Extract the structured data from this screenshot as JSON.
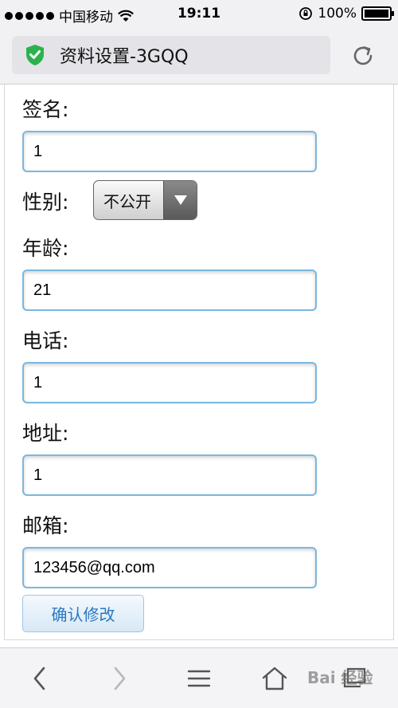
{
  "status_bar": {
    "carrier": "中国移动",
    "time": "19:11",
    "battery": "100%"
  },
  "browser": {
    "page_title": "资料设置-3GQQ"
  },
  "form": {
    "signature_label": "签名:",
    "signature_value": "1",
    "gender_label": "性别:",
    "gender_selected": "不公开",
    "age_label": "年龄:",
    "age_value": "21",
    "phone_label": "电话:",
    "phone_value": "1",
    "address_label": "地址:",
    "address_value": "1",
    "email_label": "邮箱:",
    "email_value": "123456@qq.com",
    "submit_label": "确认修改"
  },
  "watermark": "Bai 经验",
  "colors": {
    "field_border": "#7ab7e0",
    "shield_green": "#2bb24c",
    "submit_text": "#2a78c2"
  }
}
